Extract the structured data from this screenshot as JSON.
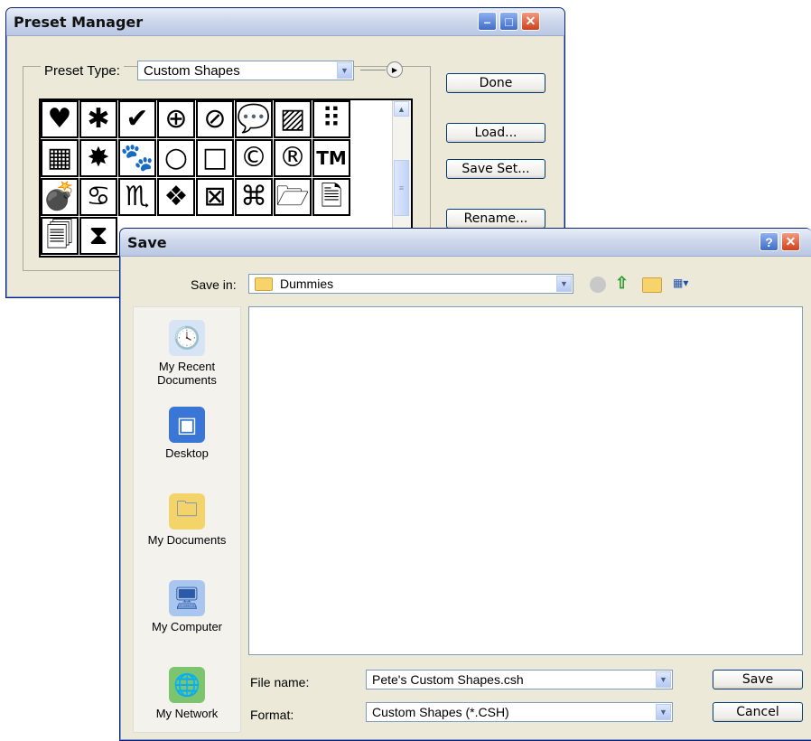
{
  "preset_manager": {
    "title": "Preset Manager",
    "preset_type_label": "Preset Type:",
    "preset_type_value": "Custom Shapes",
    "buttons": {
      "done": "Done",
      "load": "Load...",
      "save_set": "Save Set...",
      "rename": "Rename..."
    },
    "shapes": [
      [
        "♥",
        "✱",
        "✔",
        "⊕",
        "⊘",
        "💬",
        "▨",
        "⠿"
      ],
      [
        "▦",
        "✸",
        "🐾",
        "○",
        "□",
        "©",
        "®",
        "TM"
      ],
      [
        "💣",
        "♋",
        "♏",
        "❖",
        "⊠",
        "⌘",
        "🗁",
        "🗎"
      ],
      [
        "🗐",
        "⧗"
      ]
    ]
  },
  "save_dialog": {
    "title": "Save",
    "save_in_label": "Save in:",
    "save_in_value": "Dummies",
    "sidebar": [
      {
        "label": "My Recent Documents",
        "icon": "recent-documents-icon"
      },
      {
        "label": "Desktop",
        "icon": "desktop-icon"
      },
      {
        "label": "My Documents",
        "icon": "my-documents-icon"
      },
      {
        "label": "My Computer",
        "icon": "my-computer-icon"
      },
      {
        "label": "My Network",
        "icon": "my-network-icon"
      }
    ],
    "file_name_label": "File name:",
    "file_name_value": "Pete's Custom Shapes.csh",
    "format_label": "Format:",
    "format_value": "Custom Shapes (*.CSH)",
    "save_button": "Save",
    "cancel_button": "Cancel"
  }
}
